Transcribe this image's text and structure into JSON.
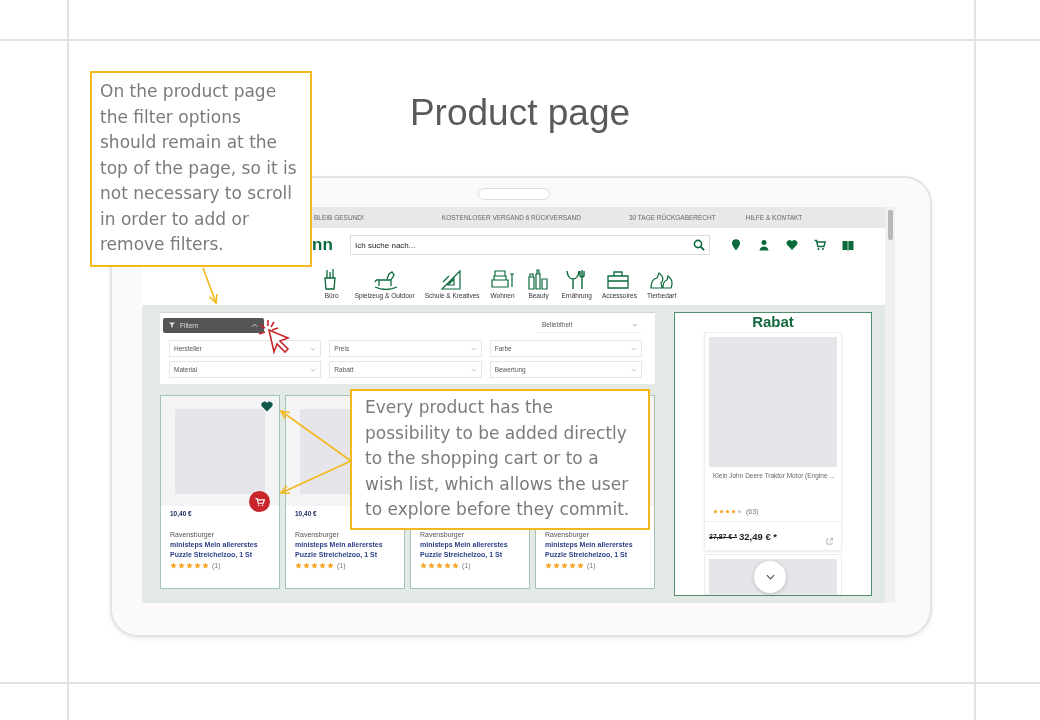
{
  "slide": {
    "title": "Product page"
  },
  "callouts": [
    {
      "text": "On the product page the filter options should remain at the top of the page, so it is not necessary to scroll in order to add or remove filters."
    },
    {
      "text": "Every product has the possibility to be added directly to the shopping cart or to a wish list, which allows the user to explore before they commit."
    }
  ],
  "screen": {
    "top_bar": [
      "BLEIB GESUND!",
      "KOSTENLOSER VERSAND 6 RÜCKVERSAND",
      "30 TAGE RÜCKGABERECHT",
      "HILFE & KONTAKT"
    ],
    "logo": "nn",
    "search": {
      "placeholder": "Ich suche nach..."
    },
    "categories": [
      {
        "label": "Büro"
      },
      {
        "label": "Spielzeug & Outdoor"
      },
      {
        "label": "Schule & Kreatives"
      },
      {
        "label": "Wohnen"
      },
      {
        "label": "Beauty"
      },
      {
        "label": "Ernährung"
      },
      {
        "label": "Accessoires"
      },
      {
        "label": "Tierbedarf"
      }
    ],
    "filter_button": {
      "label": "Filtern",
      "expanded": true
    },
    "sort": {
      "value": "Beliebtheit"
    },
    "filters": [
      "Hersteller",
      "Preis",
      "Farbe",
      "Material",
      "Rabatt",
      "Bewertung"
    ],
    "products": [
      {
        "price": "10,40 €",
        "brand": "Ravensburger",
        "title": "ministeps Mein allererstes Puzzle Streichelzoo, 1 St",
        "stars": 5,
        "rating_count": "(1)",
        "actions": true
      },
      {
        "price": "10,40 €",
        "brand": "Ravensburger",
        "title": "ministeps Mein allererstes Puzzle Streichelzoo, 1 St",
        "stars": 5,
        "rating_count": "(1)"
      },
      {
        "brand": "Ravensburger",
        "title": "ministeps Mein allererstes Puzzle Streichelzoo, 1 St",
        "stars": 5,
        "rating_count": "(1)"
      },
      {
        "brand": "Ravensburger",
        "title": "ministeps Mein allererstes Puzzle Streichelzoo, 1 St",
        "stars": 5,
        "rating_count": "(1)"
      }
    ],
    "deal_panel": {
      "heading": "Rabat",
      "product": {
        "title": "Klein John Deere Traktor Motor (Engine ...",
        "stars": 4,
        "rating_count": "(63)",
        "old_price": "37,87 € *",
        "price": "32,49 € *"
      }
    }
  }
}
